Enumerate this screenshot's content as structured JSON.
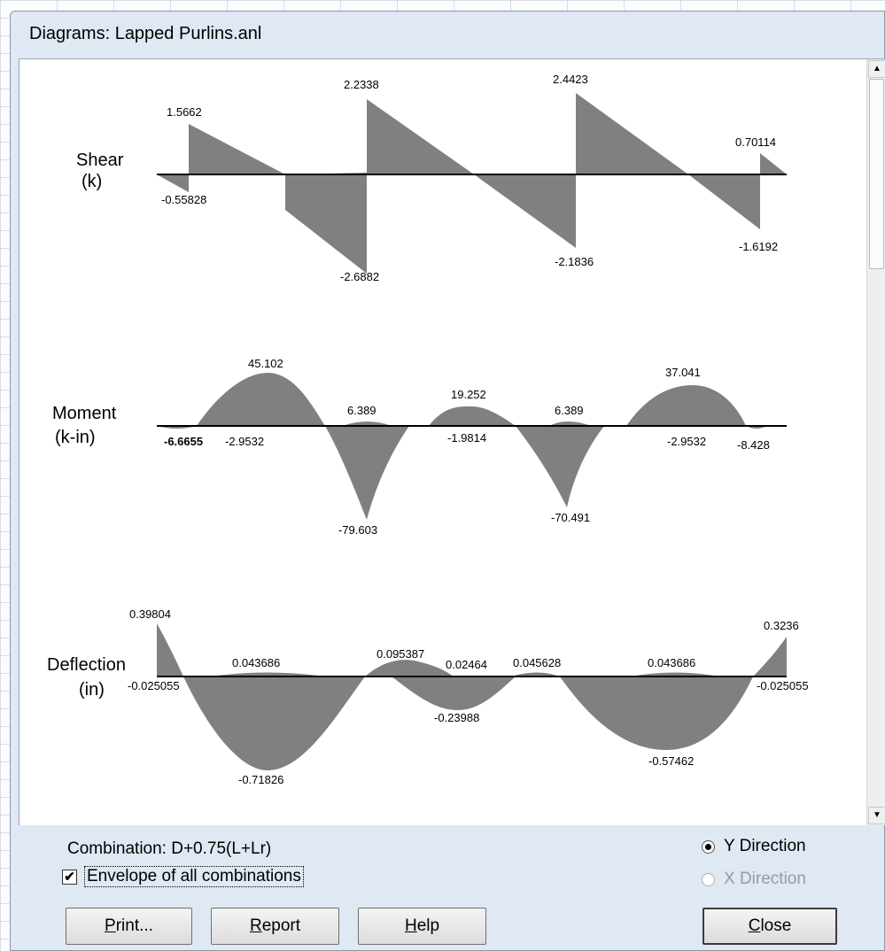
{
  "window": {
    "title": "Diagrams: Lapped Purlins.anl"
  },
  "diagrams": {
    "shear": {
      "label_line1": "Shear",
      "label_line2": "(k)",
      "values": [
        "1.5662",
        "-0.55828",
        "2.2338",
        "-2.6882",
        "2.4423",
        "-2.1836",
        "0.70114",
        "-1.6192"
      ]
    },
    "moment": {
      "label_line1": "Moment",
      "label_line2": "(k-in)",
      "values": [
        "45.102",
        "-6.6655",
        "-2.9532",
        "6.389",
        "-79.603",
        "19.252",
        "-1.9814",
        "6.389",
        "-70.491",
        "37.041",
        "-2.9532",
        "-8.428"
      ]
    },
    "deflection": {
      "label_line1": "Deflection",
      "label_line2": "(in)",
      "values": [
        "0.39804",
        "-0.025055",
        "0.043686",
        "-0.71826",
        "0.095387",
        "0.02464",
        "0.045628",
        "-0.23988",
        "0.043686",
        "-0.57462",
        "0.3236",
        "-0.025055"
      ]
    },
    "fill_color": "#808080",
    "axis_color": "#000000"
  },
  "controls": {
    "combination_label": "Combination: D+0.75(L+Lr)",
    "envelope_label": "Envelope of all combinations",
    "envelope_checked": true,
    "y_direction_label": "Y Direction",
    "y_direction_selected": true,
    "x_direction_label": "X Direction",
    "x_direction_enabled": false
  },
  "buttons": {
    "print": {
      "first": "P",
      "rest": "rint..."
    },
    "report": {
      "first": "R",
      "rest": "eport"
    },
    "help": {
      "first": "H",
      "rest": "elp"
    },
    "close": {
      "first": "C",
      "rest": "lose"
    }
  },
  "icons": {
    "scroll_up": "up-arrow",
    "scroll_down": "down-arrow"
  }
}
